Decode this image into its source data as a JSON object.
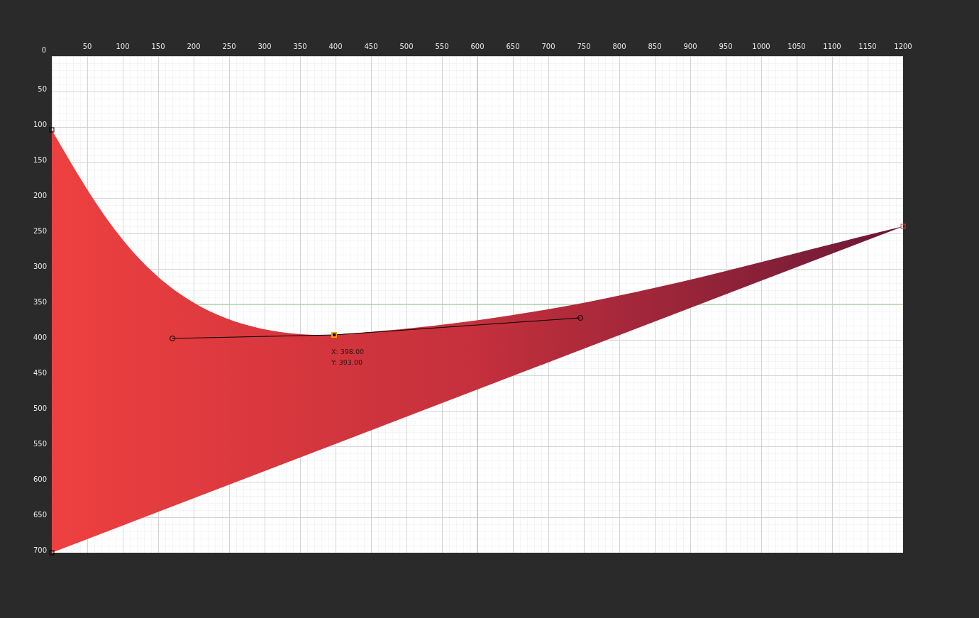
{
  "canvas": {
    "origin_label": "0",
    "x_ticks": [
      "50",
      "100",
      "150",
      "200",
      "250",
      "300",
      "350",
      "400",
      "450",
      "500",
      "550",
      "600",
      "650",
      "700",
      "750",
      "800",
      "850",
      "900",
      "950",
      "1000",
      "1050",
      "1100",
      "1150",
      "1200"
    ],
    "y_ticks": [
      "50",
      "100",
      "150",
      "200",
      "250",
      "300",
      "350",
      "400",
      "450",
      "500",
      "550",
      "600",
      "650",
      "700"
    ],
    "anchors": [
      {
        "kind": "corner",
        "selected": false
      },
      {
        "kind": "corner",
        "selected": true
      },
      {
        "kind": "closing",
        "selected": false
      },
      {
        "kind": "corner",
        "selected": false
      }
    ],
    "tooltip": {
      "x": "X: 398.00",
      "y": "Y: 393.00"
    }
  }
}
